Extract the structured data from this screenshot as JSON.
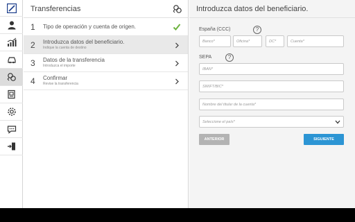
{
  "steps_panel": {
    "title": "Transferencias",
    "steps": [
      {
        "num": "1",
        "title": "Tipo de operación y cuenta de origen.",
        "subtitle": "",
        "state": "done"
      },
      {
        "num": "2",
        "title": "Introduzca datos del beneficiario.",
        "subtitle": "Indique la cuenta de destino",
        "state": "active"
      },
      {
        "num": "3",
        "title": "Datos de la transferencia",
        "subtitle": "Introduzca el importe",
        "state": "pending"
      },
      {
        "num": "4",
        "title": "Confirmar",
        "subtitle": "Revise la transferencia",
        "state": "pending"
      }
    ]
  },
  "form": {
    "title": "Introduzca datos del beneficiario.",
    "ccc_label": "España (CCC)",
    "help_glyph": "?",
    "ccc_fields": {
      "banco": "Banco*",
      "oficina": "Oficina*",
      "dc": "DC*",
      "cuenta": "Cuenta*"
    },
    "sepa_label": "SEPA",
    "iban_placeholder": "IBAN*",
    "swift_placeholder": "SWIFT/BIC*",
    "titular_placeholder": "Nombre del titular de la cuenta*",
    "pais_placeholder": "Seleccione el país*",
    "btn_prev": "ANTERIOR",
    "btn_next": "SIGUIENTE"
  },
  "rail": {
    "icons": [
      "bank-logo-icon",
      "user-icon",
      "chart-icon",
      "car-icon",
      "transfer-icon",
      "document-icon",
      "settings-icon",
      "chat-icon",
      "logout-icon"
    ],
    "active": "transfer-icon"
  },
  "colors": {
    "accent_blue": "#2c95d4",
    "check_green": "#6db33f",
    "logo_blue": "#1a3c8a",
    "disabled_gray": "#b3b3b3"
  }
}
